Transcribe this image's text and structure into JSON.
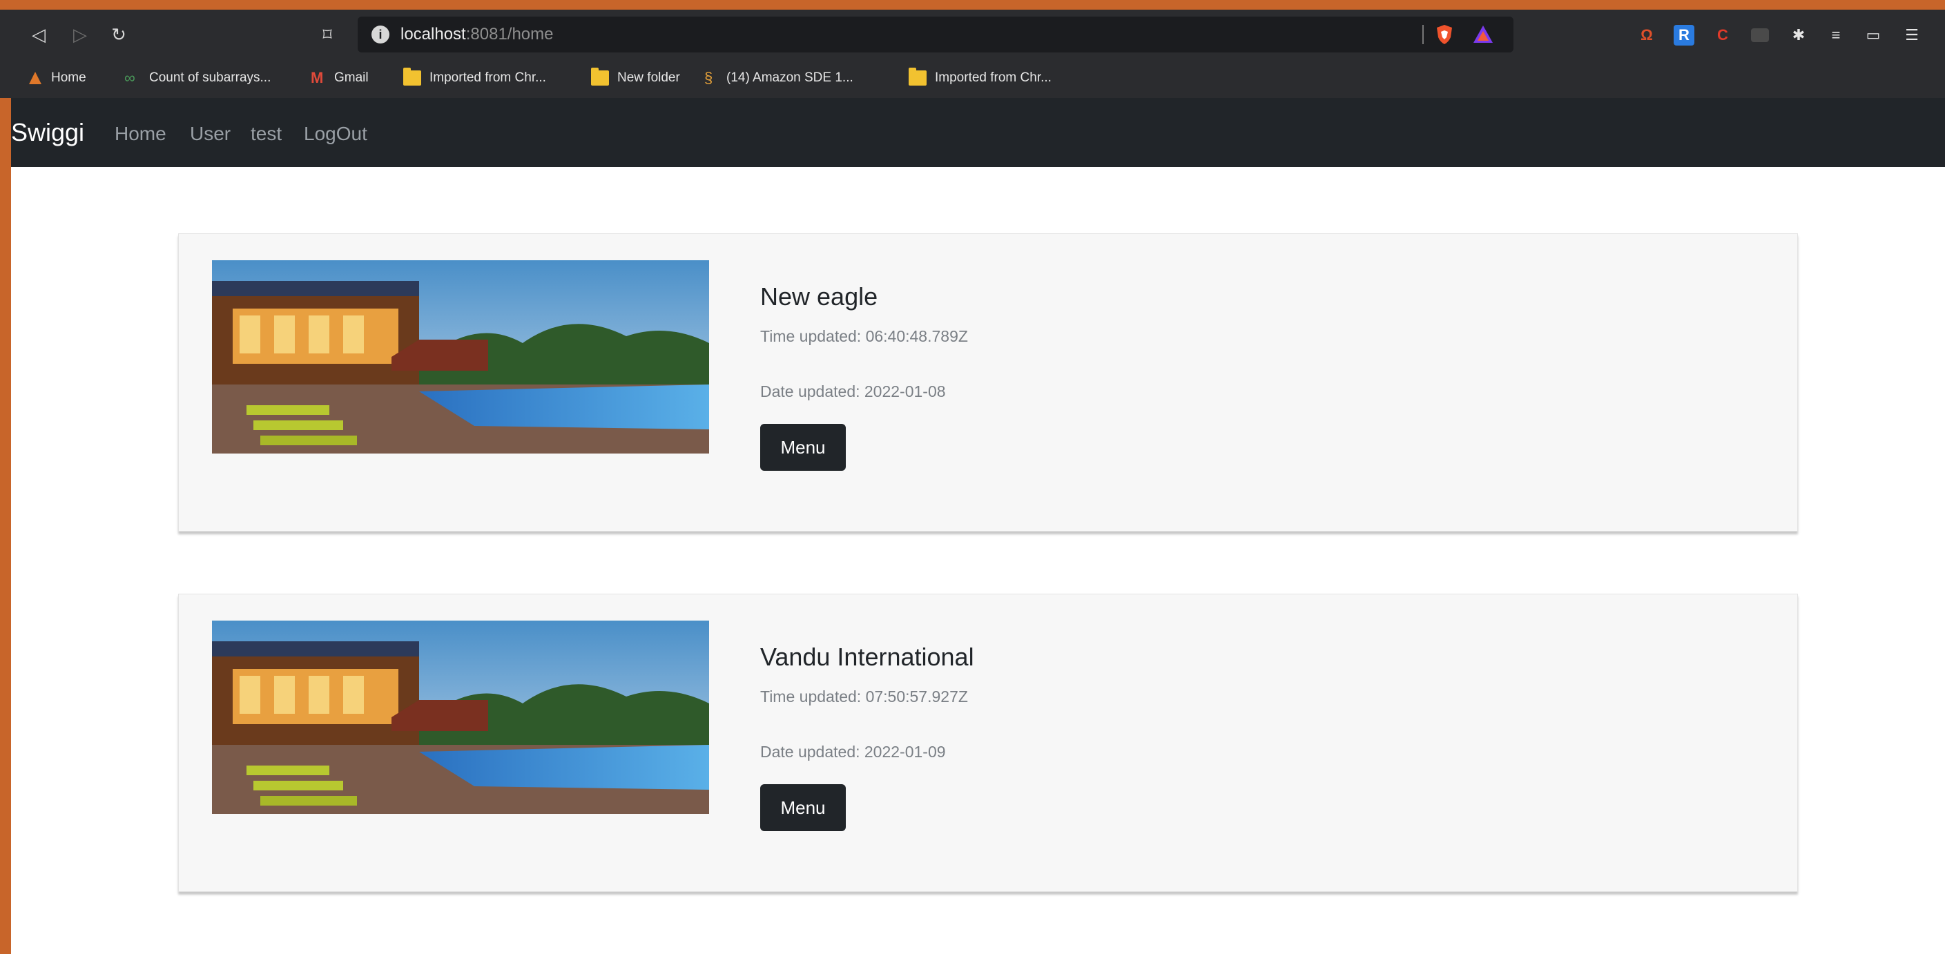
{
  "browser": {
    "url_host": "localhost",
    "url_path": ":8081/home",
    "bookmarks": [
      "Home",
      "Count of subarrays...",
      "Gmail",
      "Imported from Chr...",
      "New folder",
      "(14) Amazon SDE 1...",
      "Imported from Chr..."
    ],
    "extensions": [
      {
        "label": "Ω",
        "color": "#e0502a"
      },
      {
        "label": "R",
        "color": "#2a7be0"
      },
      {
        "label": "C",
        "color": "#e03a2a"
      }
    ]
  },
  "app": {
    "brand": "Swiggi",
    "nav": [
      "Home",
      "User",
      "test",
      "LogOut"
    ]
  },
  "restaurants": [
    {
      "name": "New eagle",
      "time": "Time updated: 06:40:48.789Z",
      "date": "Date updated: 2022-01-08",
      "button": "Menu"
    },
    {
      "name": "Vandu International",
      "time": "Time updated: 07:50:57.927Z",
      "date": "Date updated: 2022-01-09",
      "button": "Menu"
    }
  ],
  "colors": {
    "frame": "#c8652a",
    "navbar": "#212529",
    "card": "#f7f7f7"
  }
}
